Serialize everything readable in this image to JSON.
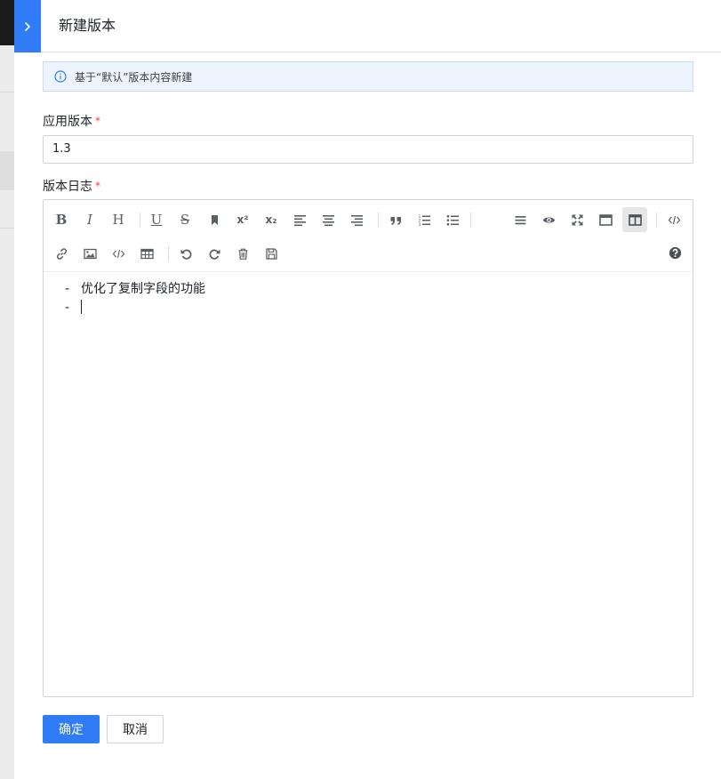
{
  "drawer": {
    "title": "新建版本",
    "info_text": "基于“默认”版本内容新建"
  },
  "form": {
    "version_label": "应用版本",
    "version_required": "*",
    "version_value": "1.3",
    "log_label": "版本日志",
    "log_required": "*"
  },
  "editor": {
    "toolbar_row1": [
      "bold",
      "italic",
      "heading",
      "underline",
      "strikethrough",
      "mark",
      "superscript",
      "subscript",
      "align-left",
      "align-center",
      "align-right",
      "quote",
      "ordered-list",
      "unordered-list",
      "menu",
      "preview",
      "fullscreen",
      "window",
      "split-view",
      "html-code"
    ],
    "toolbar_row2": [
      "link",
      "image",
      "code",
      "table",
      "undo",
      "redo",
      "trash",
      "save",
      "help"
    ],
    "bold_glyph": "B",
    "italic_glyph": "I",
    "heading_glyph": "H",
    "underline_glyph": "U",
    "strike_glyph": "S",
    "sup_glyph": "x²",
    "sub_glyph": "x₂",
    "lines": [
      {
        "bullet": "-",
        "text": "优化了复制字段的功能"
      },
      {
        "bullet": "-",
        "text": ""
      }
    ]
  },
  "actions": {
    "confirm_label": "确定",
    "cancel_label": "取消"
  },
  "colors": {
    "primary": "#2f7cf6",
    "info_bg": "#edf4fd",
    "required": "#e5484d"
  }
}
